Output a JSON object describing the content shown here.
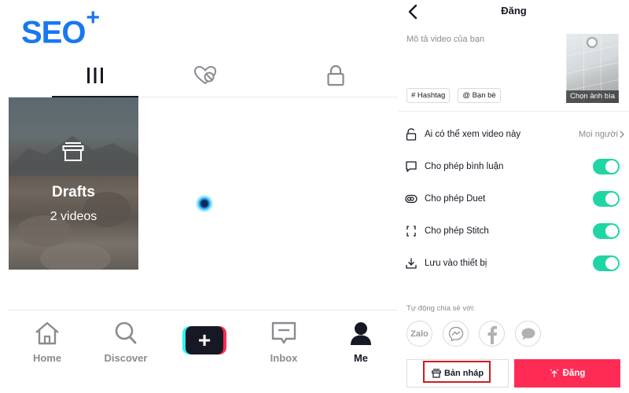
{
  "logo": {
    "text": "SEO",
    "plus": "+"
  },
  "profile": {
    "tabs": [
      {
        "name": "videos",
        "icon": "grid-icon",
        "active": true
      },
      {
        "name": "liked",
        "icon": "heart-hidden-icon",
        "active": false
      },
      {
        "name": "private",
        "icon": "lock-icon",
        "active": false
      }
    ],
    "drafts": {
      "title": "Drafts",
      "count": "2 videos"
    }
  },
  "bottom_nav": {
    "items": [
      {
        "label": "Home",
        "icon": "home-icon"
      },
      {
        "label": "Discover",
        "icon": "search-icon"
      },
      {
        "label": "",
        "icon": "plus-icon"
      },
      {
        "label": "Inbox",
        "icon": "inbox-icon"
      },
      {
        "label": "Me",
        "icon": "person-icon",
        "active": true
      }
    ]
  },
  "post": {
    "title": "Đăng",
    "description_placeholder": "Mô tả video của bạn",
    "cover_label": "Chọn ảnh bìa",
    "chips": [
      "# Hashtag",
      "@ Bạn bè"
    ],
    "settings": [
      {
        "label": "Ai có thể xem video này",
        "value": "Mọi người",
        "icon": "lock-open-icon"
      },
      {
        "label": "Cho phép bình luận",
        "toggle": true,
        "icon": "comment-icon"
      },
      {
        "label": "Cho phép Duet",
        "toggle": true,
        "icon": "duet-icon"
      },
      {
        "label": "Cho phép Stitch",
        "toggle": true,
        "icon": "stitch-icon"
      },
      {
        "label": "Lưu vào thiết bị",
        "toggle": true,
        "icon": "download-icon"
      }
    ],
    "share_label": "Tự động chia sẻ với:",
    "share_targets": [
      {
        "name": "Zalo",
        "icon": "zalo-icon"
      },
      {
        "name": "Messenger",
        "icon": "messenger-icon"
      },
      {
        "name": "Facebook",
        "icon": "facebook-icon"
      },
      {
        "name": "Messages",
        "icon": "chat-icon"
      }
    ],
    "draft_button": "Bản nháp",
    "post_button": "Đăng"
  },
  "colors": {
    "brand_blue": "#1877f2",
    "toggle_on": "#20d5a4",
    "post_red": "#fe2c55",
    "highlight_red": "#d01b24"
  }
}
